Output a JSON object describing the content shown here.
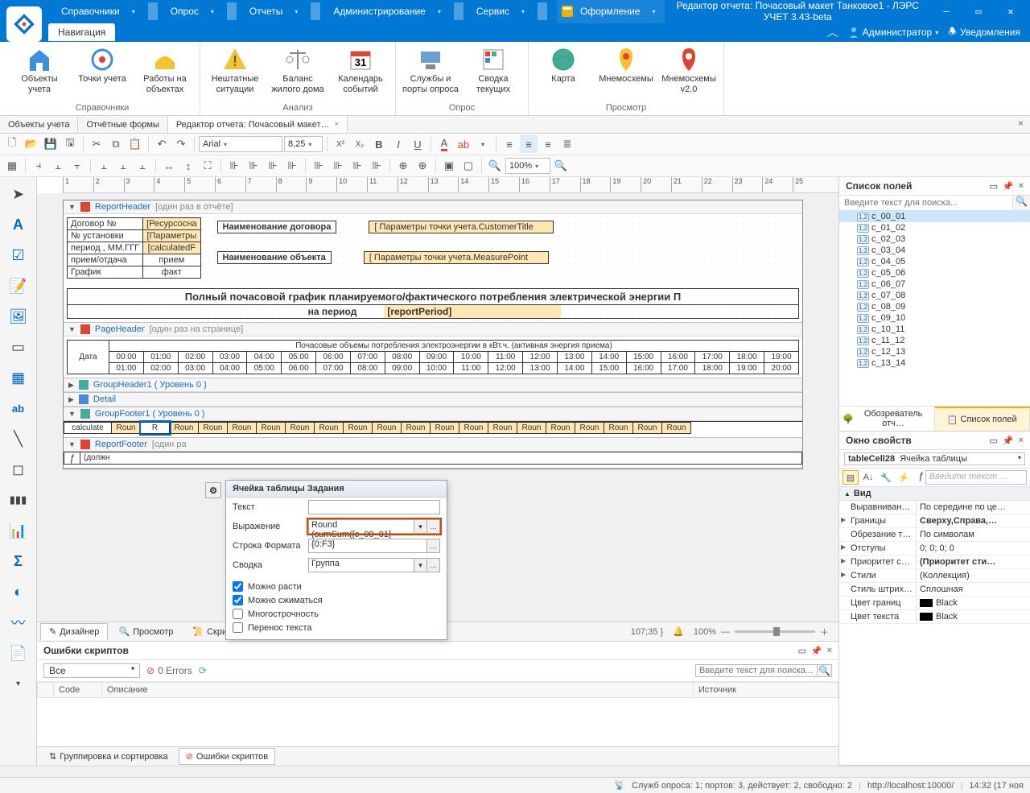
{
  "window": {
    "title": "Редактор отчета: Почасовый макет Танковое1 - ЛЭРС УЧЕТ 3.43-beta"
  },
  "topmenu": {
    "items": [
      "Справочники",
      "Опрос",
      "Отчеты",
      "Администрирование",
      "Сервис"
    ],
    "theme_btn": "Оформление"
  },
  "secondbar": {
    "nav_tab": "Навигация",
    "user": "Администратор",
    "notifications": "Уведомления"
  },
  "ribbon": {
    "groups": [
      {
        "label": "Справочники",
        "items": [
          "Объекты учета",
          "Точки учета",
          "Работы на объектах"
        ]
      },
      {
        "label": "Анализ",
        "items": [
          "Нештатные ситуации",
          "Баланс жилого дома",
          "Календарь событий"
        ]
      },
      {
        "label": "Опрос",
        "items": [
          "Службы и порты опроса",
          "Сводка текущих"
        ]
      },
      {
        "label": "Просмотр",
        "items": [
          "Карта",
          "Мнемосхемы",
          "Мнемосхемы v2.0"
        ]
      }
    ]
  },
  "doctabs": {
    "tabs": [
      {
        "label": "Объекты учета",
        "closable": false
      },
      {
        "label": "Отчётные формы",
        "closable": false
      },
      {
        "label": "Редактор отчета: Почасовый макет…",
        "closable": true,
        "active": true
      }
    ]
  },
  "toolbar1": {
    "font": "Arial",
    "size": "8,25"
  },
  "toolbar2": {
    "zoom": "100%"
  },
  "report": {
    "header_band": "ReportHeader",
    "header_hint": "[один раз в отчёте]",
    "page_header": "PageHeader",
    "page_hint": "[один раз на странице]",
    "group_header": "GroupHeader1 ( Уровень 0 )",
    "detail": "Detail",
    "group_footer": "GroupFooter1 ( Уровень 0 )",
    "report_footer": "ReportFooter",
    "report_footer_hint": "[один ра",
    "labels": {
      "contract": "Договор №",
      "contract_val": "[Ресурсосна",
      "install": "№ установки",
      "install_val": "[Параметры",
      "period": "период , ММ.ГГГ",
      "period_val": "[calculatedF",
      "io": "прием/отдача",
      "io_val": "прием",
      "graph": "График",
      "graph_val": "факт",
      "nm_contract": "Наименование договора",
      "nm_contract_val": "[  Параметры точки учета.CustomerTitle",
      "nm_object": "Наименование объекта",
      "nm_object_val": "[  Параметры точки учета.MeasurePoint",
      "title": "Полный почасовой график планируемого/фактического потребления электрической энергии П",
      "subtitle_lbl": "на период",
      "subtitle_val": "[reportPeriod]",
      "hour_caption": "Почасовые объемы потребления электроэнергии в  кВт.ч. (активная энергия приема)",
      "date": "Дата",
      "calc": "calculate",
      "round": "Roun",
      "r": "R",
      "fx": "ƒ",
      "dol": "(должн",
      "coords": "107;35 }"
    },
    "hours": [
      [
        "00:00",
        "01:00",
        "02:00",
        "03:00",
        "04:00",
        "05:00",
        "06:00",
        "07:00",
        "08:00",
        "09:00",
        "10:00",
        "11:00",
        "12:00",
        "13:00",
        "14:00",
        "15:00",
        "16:00",
        "17:00",
        "18:00",
        "19:00"
      ],
      [
        "01:00",
        "02:00",
        "03:00",
        "04:00",
        "05:00",
        "06:00",
        "07:00",
        "08:00",
        "09:00",
        "10:00",
        "11:00",
        "12:00",
        "13:00",
        "14:00",
        "15:00",
        "16:00",
        "17:00",
        "18:00",
        "19:00",
        "20:00"
      ]
    ]
  },
  "gear_popup": {
    "title": "Ячейка таблицы Задания",
    "rows": {
      "text": "Текст",
      "expr": "Выражение",
      "expr_val": "Round (sumSum([c_00_01]",
      "format": "Строка Формата",
      "format_val": "{0:F3}",
      "summary": "Сводка",
      "summary_val": "Группа"
    },
    "checks": {
      "grow": "Можно расти",
      "shrink": "Можно сжиматься",
      "multiline": "Многострочность",
      "wrap": "Перенос текста"
    }
  },
  "design_tabs": {
    "designer": "Дизайнер",
    "preview": "Просмотр",
    "scripts": "Скри",
    "zoom": "100%"
  },
  "errors_panel": {
    "title": "Ошибки скриптов",
    "filter_all": "Все",
    "zero_errors": "0 Errors",
    "search_ph": "Введите текст для поиска...",
    "cols": {
      "code": "Code",
      "desc": "Описание",
      "src": "Источник"
    }
  },
  "bottom_strip": {
    "group_sort": "Группировка и сортировка",
    "script_err": "Ошибки скриптов"
  },
  "fields_pane": {
    "title": "Список полей",
    "search_ph": "Введите текст для поиска...",
    "items": [
      "c_00_01",
      "c_01_02",
      "c_02_03",
      "c_03_04",
      "c_04_05",
      "c_05_06",
      "c_06_07",
      "c_07_08",
      "c_08_09",
      "c_09_10",
      "c_10_11",
      "c_11_12",
      "c_12_13",
      "c_13_14"
    ],
    "tab_explorer": "Обозреватель отч…",
    "tab_fields": "Список полей"
  },
  "props_pane": {
    "title": "Окно свойств",
    "object_id": "tableCell28",
    "object_type": "Ячейка таблицы",
    "expr_ph": "Введите текст …",
    "cat_view": "Вид",
    "rows": [
      {
        "k": "Выравнивани…",
        "v": "По середине по це…",
        "exp": false
      },
      {
        "k": "Границы",
        "v": "Сверху,Справа,…",
        "bold": true,
        "exp": true
      },
      {
        "k": "Обрезание т…",
        "v": "По символам",
        "exp": false
      },
      {
        "k": "Отступы",
        "v": "0; 0; 0; 0",
        "exp": true
      },
      {
        "k": "Приоритет ст…",
        "v": "(Приоритет сти…",
        "bold": true,
        "exp": true
      },
      {
        "k": "Стили",
        "v": "(Коллекция)",
        "exp": true
      },
      {
        "k": "Стиль штрих…",
        "v": "Сплошная",
        "exp": false
      },
      {
        "k": "Цвет границ",
        "v": "Black",
        "swatch": true,
        "exp": false
      },
      {
        "k": "Цвет текста",
        "v": "Black",
        "swatch": true,
        "exp": false
      }
    ]
  },
  "statusbar": {
    "services": "Служб опроса: 1; портов: 3, действует: 2, свободно: 2",
    "url": "http://localhost:10000/",
    "time": "14:32 (17 ноя"
  }
}
